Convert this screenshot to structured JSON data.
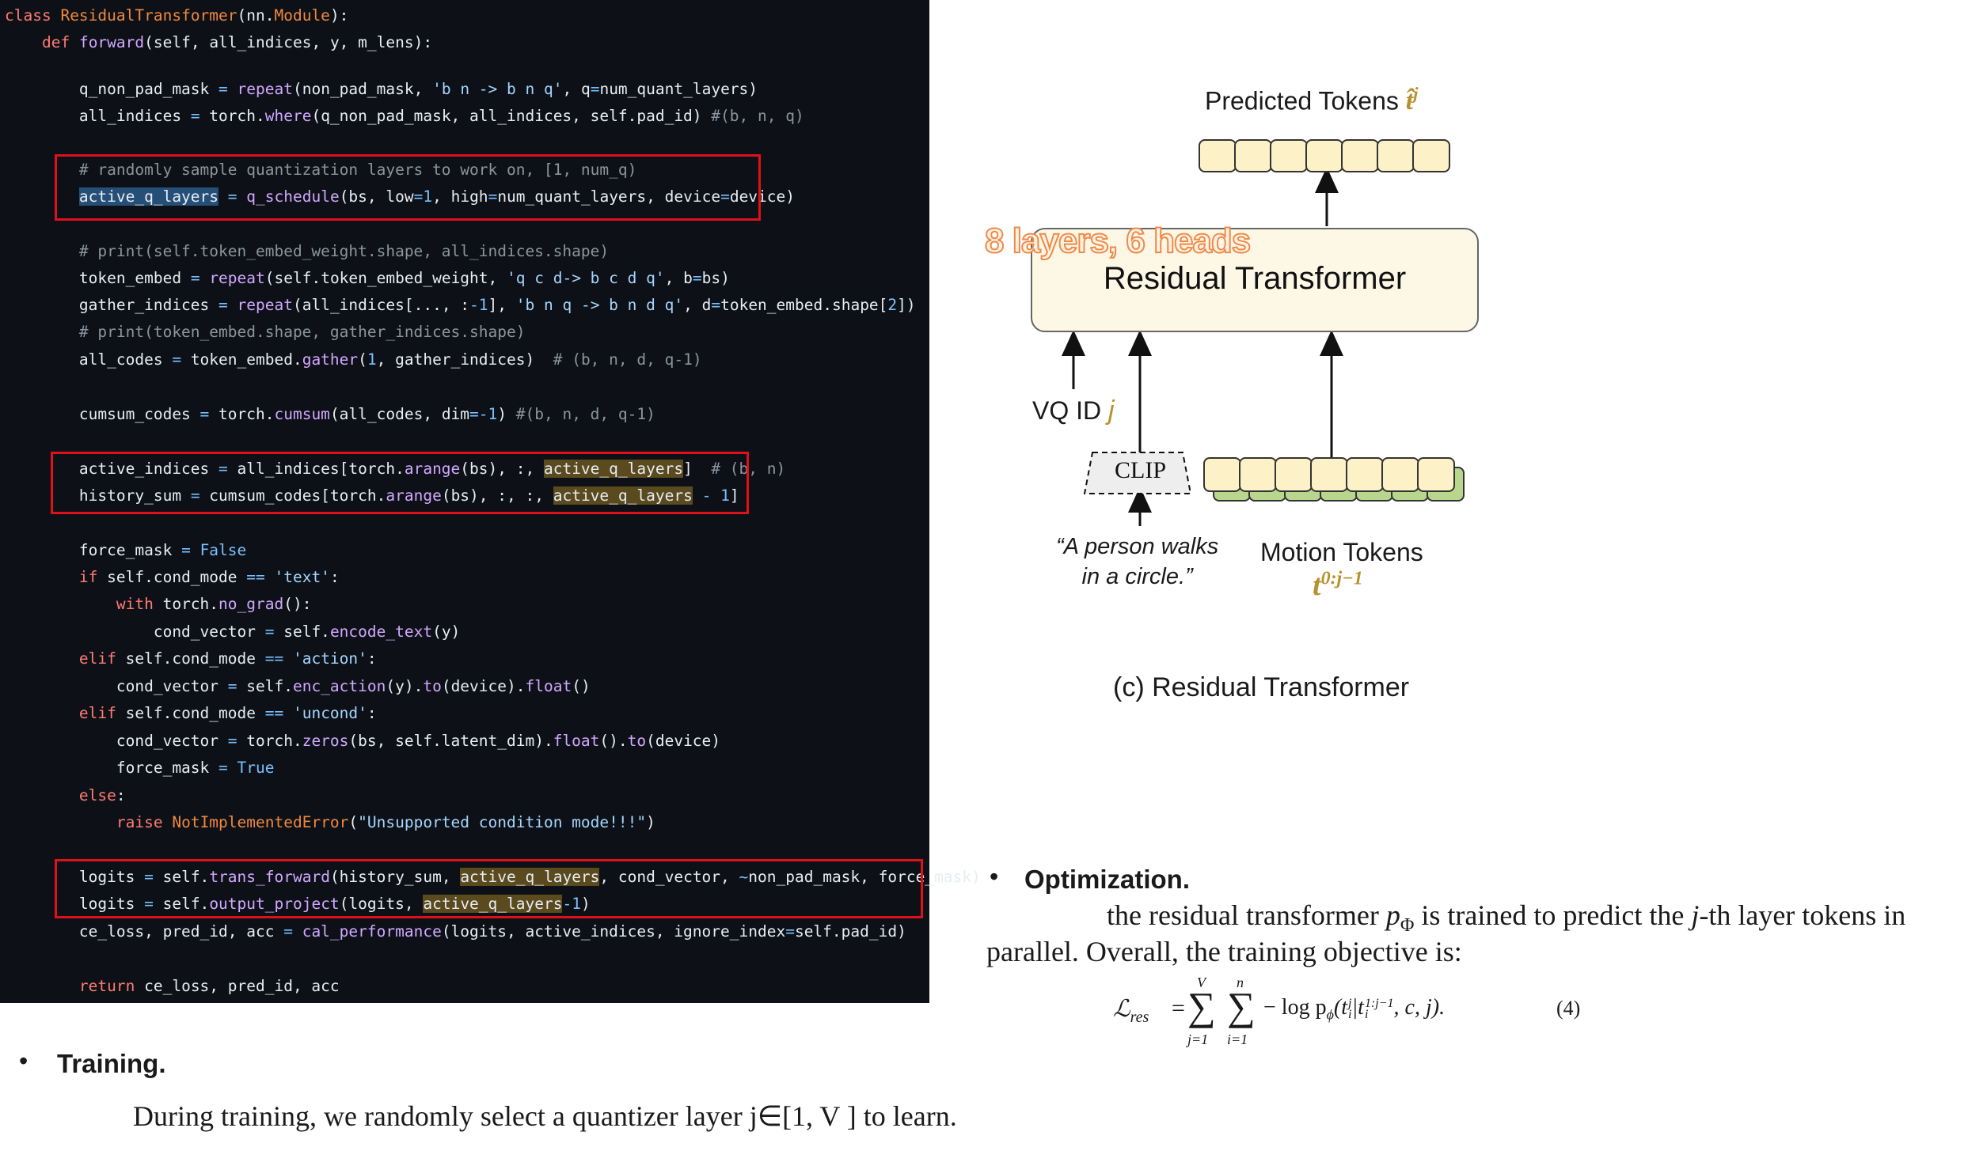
{
  "code": {
    "lines": [
      "class ResidualTransformer(nn.Module):",
      "    def forward(self, all_indices, y, m_lens):",
      "        q_non_pad_mask = repeat(non_pad_mask, 'b n -> b n q', q=num_quant_layers)",
      "        all_indices = torch.where(q_non_pad_mask, all_indices, self.pad_id) #(b, n, q)",
      "        # randomly sample quantization layers to work on, [1, num_q)",
      "        active_q_layers = q_schedule(bs, low=1, high=num_quant_layers, device=device)",
      "        # print(self.token_embed_weight.shape, all_indices.shape)",
      "        token_embed = repeat(self.token_embed_weight, 'q c d-> b c d q', b=bs)",
      "        gather_indices = repeat(all_indices[..., :-1], 'b n q -> b n d q', d=token_embed.shape[2])",
      "        # print(token_embed.shape, gather_indices.shape)",
      "        all_codes = token_embed.gather(1, gather_indices)  # (b, n, d, q-1)",
      "        cumsum_codes = torch.cumsum(all_codes, dim=-1) #(b, n, d, q-1)",
      "        active_indices = all_indices[torch.arange(bs), :, active_q_layers]  # (b, n)",
      "        history_sum = cumsum_codes[torch.arange(bs), :, :, active_q_layers - 1]",
      "        force_mask = False",
      "        if self.cond_mode == 'text':",
      "            with torch.no_grad():",
      "                cond_vector = self.encode_text(y)",
      "        elif self.cond_mode == 'action':",
      "            cond_vector = self.enc_action(y).to(device).float()",
      "        elif self.cond_mode == 'uncond':",
      "            cond_vector = torch.zeros(bs, self.latent_dim).float().to(device)",
      "            force_mask = True",
      "        else:",
      "            raise NotImplementedError(\"Unsupported condition mode!!!\")",
      "        logits = self.trans_forward(history_sum, active_q_layers, cond_vector, ~non_pad_mask, force_mask)",
      "        logits = self.output_project(logits, active_q_layers-1)",
      "        ce_loss, pred_id, acc = cal_performance(logits, active_indices, ignore_index=self.pad_id)",
      "        return ce_loss, pred_id, acc"
    ]
  },
  "diagram": {
    "predicted_tokens_label": "Predicted Tokens",
    "predicted_tokens_symbol": "t̂",
    "predicted_tokens_sup": "j",
    "annotation": "8 layers, 6 heads",
    "block_label": "Residual Transformer",
    "vq_id_label": "VQ ID",
    "vq_id_symbol": "j",
    "clip_label": "CLIP",
    "quote_line1": "“A person walks",
    "quote_line2": "in a circle.”",
    "motion_tokens_label": "Motion Tokens",
    "motion_tokens_symbol": "t",
    "motion_tokens_sup": "0:j−1",
    "caption": "(c) Residual Transformer"
  },
  "optimization": {
    "bullet": "•",
    "heading": "Optimization.",
    "line1_a": "the residual transformer ",
    "line1_p": "p",
    "line1_sub": "Φ",
    "line1_b": " is trained to predict the ",
    "line1_j": "j",
    "line1_c": "-th layer tokens in",
    "line2": "parallel. Overall, the training objective is:",
    "eq_lhs": "ℒ",
    "eq_lhs_sub": "res",
    "eq_sum1_top": "V",
    "eq_sum1_bot": "j=1",
    "eq_sum2_top": "n",
    "eq_sum2_bot": "i=1",
    "eq_body": "− log p",
    "eq_body_sub": "ϕ",
    "eq_args_a": "(t",
    "eq_args_sup1": "j",
    "eq_args_sub1": "i",
    "eq_args_b": "|t",
    "eq_args_sup2": "1:j−1",
    "eq_args_sub2": "i",
    "eq_args_c": ", c, j).",
    "eq_number": "(4)"
  },
  "training": {
    "bullet": "•",
    "heading": "Training.",
    "body": "During training, we randomly select a quantizer layer j∈[1, V ] to learn."
  }
}
